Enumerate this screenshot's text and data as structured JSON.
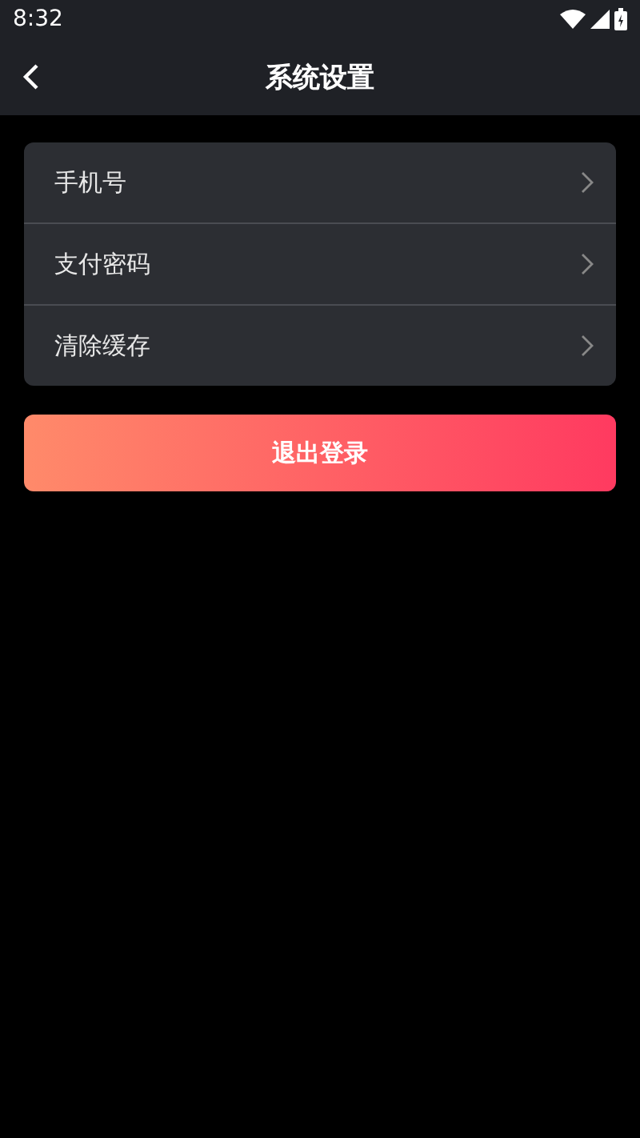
{
  "status_bar": {
    "time": "8:32"
  },
  "header": {
    "title": "系统设置"
  },
  "settings": [
    {
      "label": "手机号"
    },
    {
      "label": "支付密码"
    },
    {
      "label": "清除缓存"
    }
  ],
  "logout_button": {
    "label": "退出登录"
  }
}
